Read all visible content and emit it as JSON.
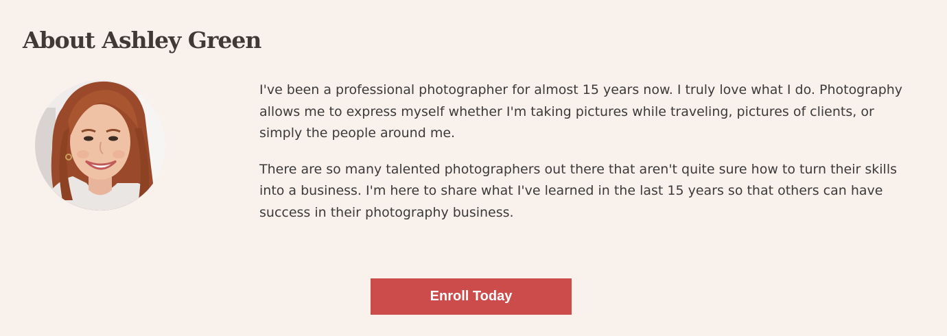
{
  "about": {
    "title": "About Ashley Green",
    "paragraphs": [
      "I've been a professional photographer for almost 15 years now. I truly love what I do. Photography allows me to express myself whether I'm taking pictures while traveling, pictures of clients, or simply the people around me.",
      "There are so many talented photographers out there that aren't quite sure how to turn their skills into a business. I'm here to share what I've learned in the last 15 years so that others can have success in their photography business."
    ]
  },
  "cta": {
    "label": "Enroll Today"
  },
  "colors": {
    "background": "#f9f1ec",
    "accent": "#cc4b4b",
    "text": "#3b3a3a"
  }
}
